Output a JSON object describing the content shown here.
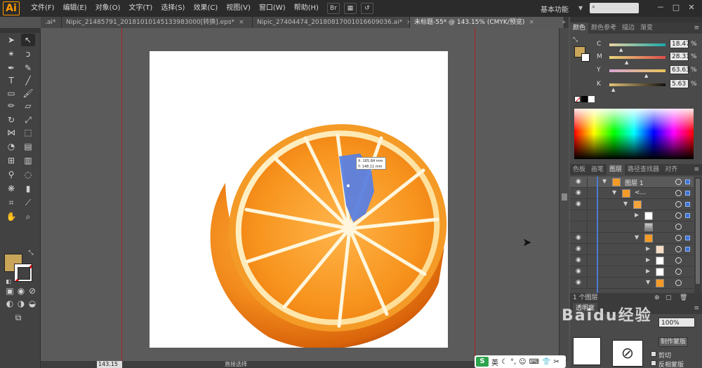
{
  "app": {
    "logo": "Ai",
    "menus": [
      "文件(F)",
      "编辑(E)",
      "对象(O)",
      "文字(T)",
      "选择(S)",
      "效果(C)",
      "视图(V)",
      "窗口(W)",
      "帮助(H)"
    ],
    "workspace_label": "基本功能",
    "search_placeholder": "",
    "window_controls": [
      "－",
      "□",
      "✕"
    ]
  },
  "tabs": [
    {
      "label": ".ai*",
      "active": false
    },
    {
      "label": "Nipic_21485791_20181010145133983000[转换].eps*",
      "active": false
    },
    {
      "label": "Nipic_27404474_20180817001016609036.ai*",
      "active": false
    },
    {
      "label": "未标题-55* @ 143.15% (CMYK/预览)",
      "active": true
    }
  ],
  "canvas": {
    "tooltip_x": "X: 165.84 mm",
    "tooltip_y": "Y: 148.11 mm"
  },
  "color_panel": {
    "tabs": [
      "颜色",
      "颜色参考",
      "描边",
      "渐变"
    ],
    "rows": [
      {
        "label": "C",
        "value": "18.47",
        "unit": "%",
        "level": 0.18
      },
      {
        "label": "M",
        "value": "28.31",
        "unit": "%",
        "level": 0.28
      },
      {
        "label": "Y",
        "value": "63.63",
        "unit": "%",
        "level": 0.64
      },
      {
        "label": "K",
        "value": "5.63",
        "unit": "%",
        "level": 0.06
      }
    ],
    "fill_color": "#c9a55a"
  },
  "layers_panel": {
    "tabs": [
      "色板",
      "画笔",
      "图层",
      "路径查找器",
      "对齐"
    ],
    "active_tab": "图层",
    "top_layer_name": "图层 1",
    "sublayer_name": "<...",
    "footer": "1 个图层"
  },
  "transparency_panel": {
    "tab": "透明度",
    "opacity": "100%",
    "mask_button": "制作蒙版",
    "clip_label": "剪切",
    "invert_label": "反相蒙版"
  },
  "status": {
    "zoom": "143.15",
    "tool": "直接选择"
  },
  "ime": {
    "logo": "S",
    "mode": "英"
  },
  "watermark": "Baidu经验"
}
